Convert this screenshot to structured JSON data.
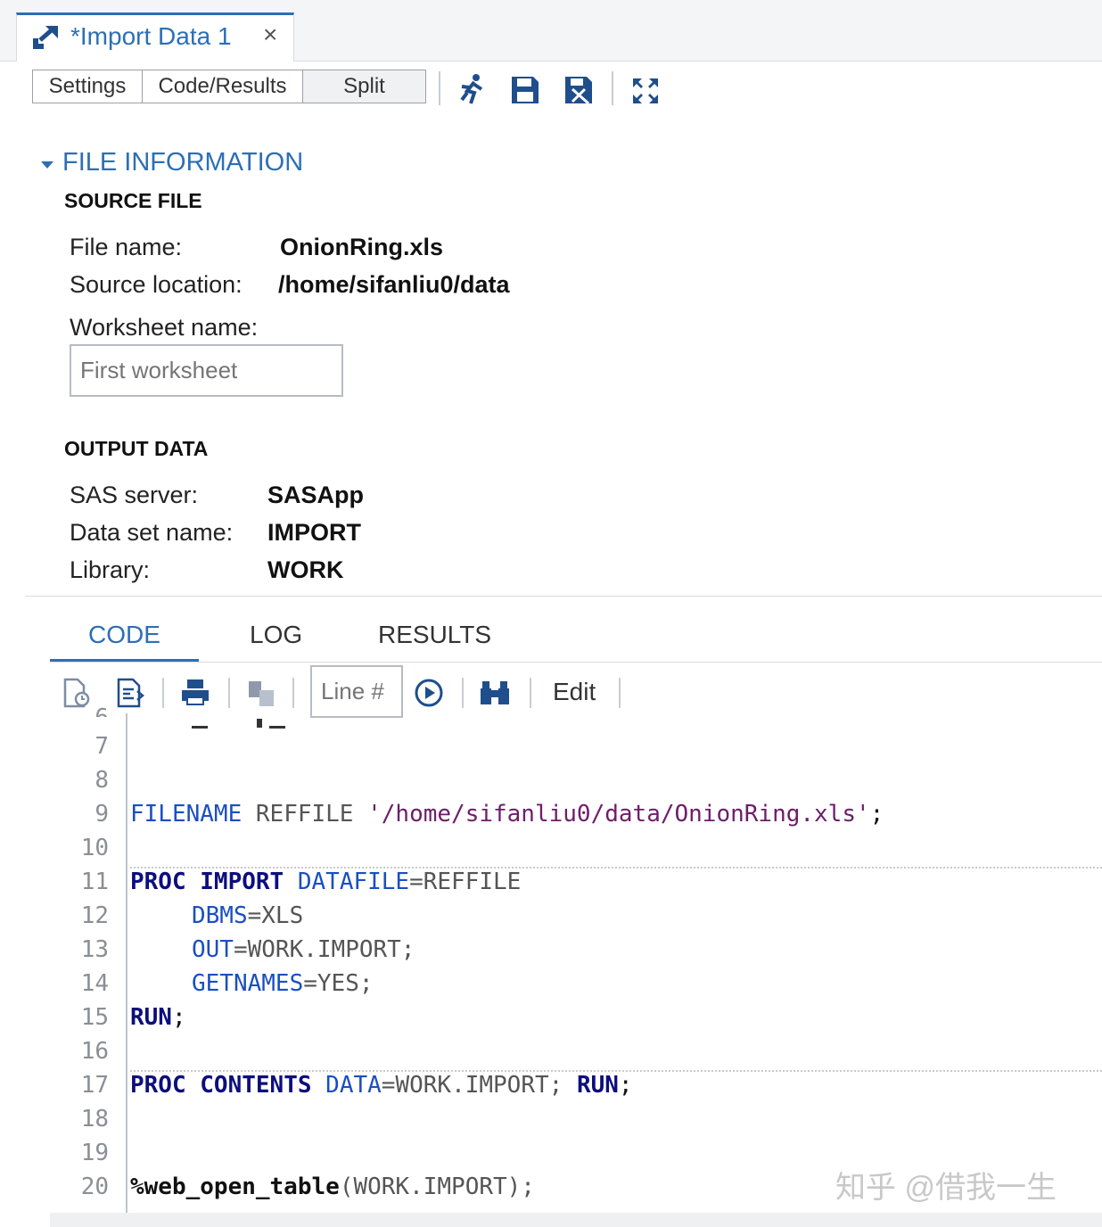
{
  "tab": {
    "title": "*Import Data 1",
    "close": "×"
  },
  "toolbar": {
    "buttons": [
      "Settings",
      "Code/Results",
      "Split"
    ],
    "icons": [
      "run-icon",
      "save-icon",
      "save-as-icon",
      "maximize-icon"
    ]
  },
  "file_info": {
    "section_title": "FILE INFORMATION",
    "source_heading": "SOURCE FILE",
    "file_name_label": "File name:",
    "file_name_value": "OnionRing.xls",
    "source_location_label": "Source location:",
    "source_location_value": "/home/sifanliu0/data",
    "worksheet_label": "Worksheet name:",
    "worksheet_placeholder": "First worksheet",
    "output_heading": "OUTPUT DATA",
    "server_label": "SAS server:",
    "server_value": "SASApp",
    "dataset_label": "Data set name:",
    "dataset_value": "IMPORT",
    "library_label": "Library:",
    "library_value": "WORK"
  },
  "code_tabs": [
    "CODE",
    "LOG",
    "RESULTS"
  ],
  "code_toolbar": {
    "line_placeholder": "Line #",
    "edit_label": "Edit"
  },
  "code": {
    "line_numbers": [
      "7",
      "8",
      "9",
      "10",
      "11",
      "12",
      "13",
      "14",
      "15",
      "16",
      "17",
      "18",
      "19",
      "20"
    ],
    "line9": {
      "k1": "FILENAME",
      "t1": " REFFILE ",
      "s1": "'/home/sifanliu0/data/OnionRing.xls'",
      "t2": ";"
    },
    "line11": {
      "k1": "PROC",
      "t1": " ",
      "k2": "IMPORT",
      "t2": " ",
      "o1": "DATAFILE",
      "t3": "=REFFILE"
    },
    "line12": {
      "o1": "DBMS",
      "t1": "=XLS"
    },
    "line13": {
      "o1": "OUT",
      "t1": "=WORK.IMPORT;"
    },
    "line14": {
      "o1": "GETNAMES",
      "t1": "=YES;"
    },
    "line15": {
      "k1": "RUN",
      "t1": ";"
    },
    "line17": {
      "k1": "PROC",
      "t1": " ",
      "k2": "CONTENTS",
      "t2": " ",
      "o1": "DATA",
      "t3": "=WORK.IMPORT; ",
      "k3": "RUN",
      "t4": ";"
    },
    "line20": {
      "m1": "%web_open_table",
      "t1": "(WORK.IMPORT);"
    }
  },
  "watermark": "知乎 @借我一生"
}
